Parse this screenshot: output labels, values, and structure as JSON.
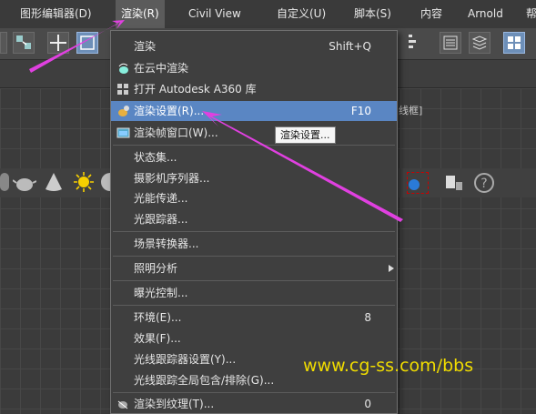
{
  "menubar": {
    "items": [
      {
        "label": "图形编辑器(D)"
      },
      {
        "label": "渲染(R)",
        "active": true
      },
      {
        "label": "Civil View"
      },
      {
        "label": "自定义(U)"
      },
      {
        "label": "脚本(S)"
      },
      {
        "label": "内容"
      },
      {
        "label": "Arnold"
      },
      {
        "label": "帮"
      }
    ]
  },
  "viewport": {
    "label": "线框]"
  },
  "dropdown": {
    "items": [
      {
        "label": "渲染",
        "shortcut": "Shift+Q",
        "icon": null
      },
      {
        "label": "在云中渲染",
        "icon": "cloud-teapot-icon"
      },
      {
        "label": "打开 Autodesk A360 库",
        "icon": "a360-gallery-icon"
      },
      {
        "label": "渲染设置(R)...",
        "shortcut": "F10",
        "icon": "render-setup-icon",
        "highlighted": true
      },
      {
        "label": "渲染帧窗口(W)...",
        "icon": "render-frame-window-icon"
      },
      {
        "label": "状态集..."
      },
      {
        "label": "摄影机序列器..."
      },
      {
        "label": "光能传递..."
      },
      {
        "label": "光跟踪器..."
      },
      {
        "label": "场景转换器..."
      },
      {
        "label": "照明分析",
        "submenu": true
      },
      {
        "label": "曝光控制..."
      },
      {
        "label": "环境(E)...",
        "shortcut": "8"
      },
      {
        "label": "效果(F)..."
      },
      {
        "label": "光线跟踪器设置(Y)..."
      },
      {
        "label": "光线跟踪全局包含/排除(G)..."
      },
      {
        "label": "渲染到纹理(T)...",
        "shortcut": "0",
        "icon": "render-to-texture-icon"
      }
    ]
  },
  "tooltip": {
    "text": "渲染设置..."
  },
  "watermark": {
    "text": "www.cg-ss.com/bbs"
  },
  "colors": {
    "highlight": "#5a86c3",
    "annotation_arrow": "#e040e0",
    "watermark": "#f0dc00"
  }
}
